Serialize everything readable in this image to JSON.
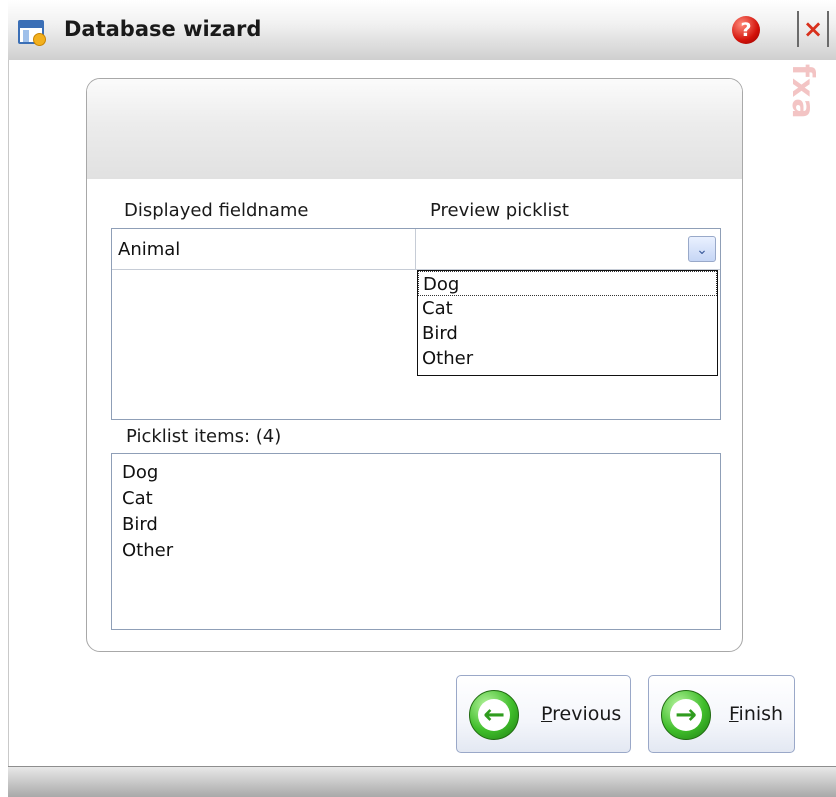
{
  "window": {
    "title": "Database wizard",
    "help_glyph": "?",
    "close_glyph": "×",
    "watermark": "fxa"
  },
  "grid": {
    "col_fieldname_header": "Displayed fieldname",
    "col_preview_header": "Preview picklist",
    "row": {
      "fieldname": "Animal",
      "preview_value": ""
    },
    "dropdown_glyph": "⌄",
    "dropdown_items": [
      "Dog",
      "Cat",
      "Bird",
      "Other"
    ],
    "focused_item_index": 0
  },
  "picklist": {
    "label": "Picklist items: (4)",
    "items": [
      "Dog",
      "Cat",
      "Bird",
      "Other"
    ]
  },
  "buttons": {
    "previous": {
      "accel": "P",
      "rest": "revious",
      "icon_glyph": "←"
    },
    "finish": {
      "accel": "F",
      "rest": "inish",
      "icon_glyph": "→"
    }
  },
  "colors": {
    "accent_blue": "#3b6fb6",
    "button_green": "#3fbd2a",
    "help_red": "#d3120a"
  },
  "icons": {
    "app": "database-wizard-icon",
    "help": "help-icon",
    "close": "close-icon",
    "previous": "arrow-left-icon",
    "finish": "arrow-right-icon"
  }
}
